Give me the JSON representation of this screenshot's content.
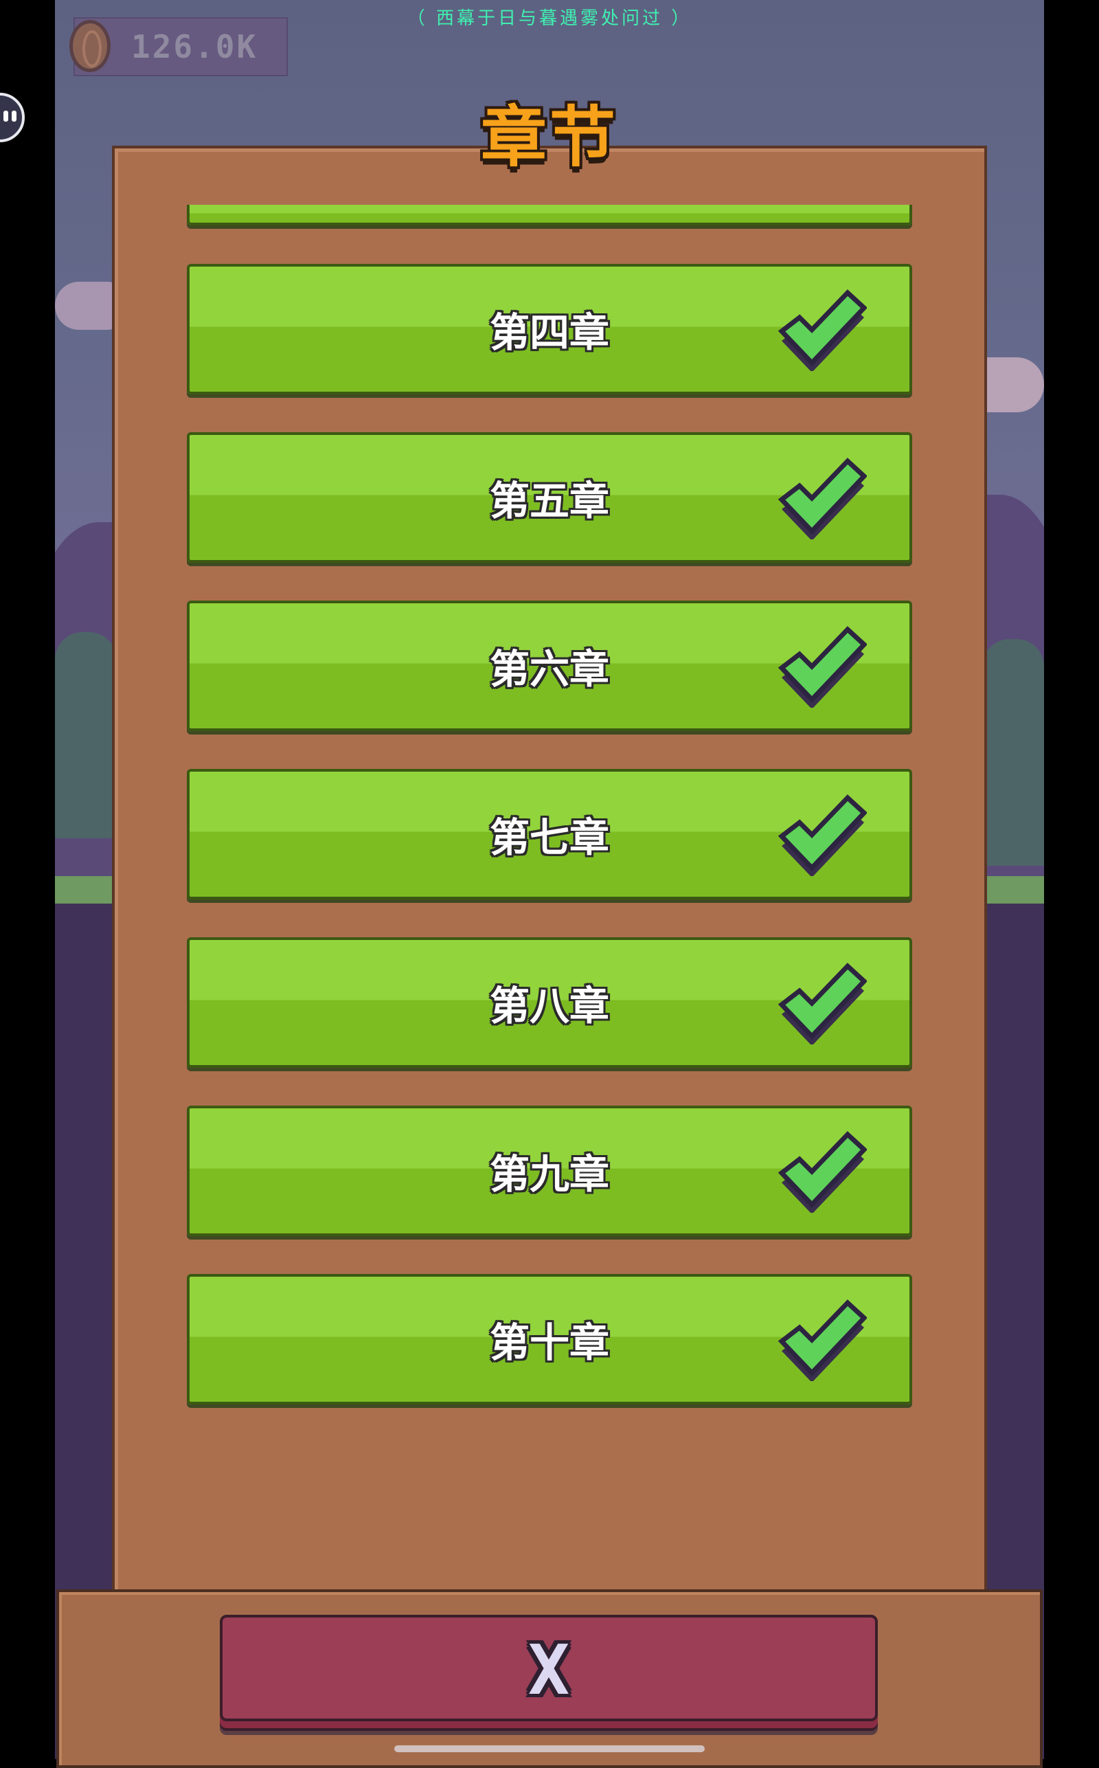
{
  "hud": {
    "subtitle": "（ 西幕于日与暮遇雾处问过 ）",
    "coins": "126.0K",
    "coin_icon": "coin-icon"
  },
  "screen_title": "章节",
  "chapters": [
    {
      "label": "第四章",
      "completed": true
    },
    {
      "label": "第五章",
      "completed": true
    },
    {
      "label": "第六章",
      "completed": true
    },
    {
      "label": "第七章",
      "completed": true
    },
    {
      "label": "第八章",
      "completed": true
    },
    {
      "label": "第九章",
      "completed": true
    },
    {
      "label": "第十章",
      "completed": true
    }
  ],
  "close_button": {
    "label": "X"
  },
  "colors": {
    "button_green": "#92d43c",
    "button_green_dark": "#7dbd22",
    "check_fill": "#5fd25a",
    "check_outline": "#2c2440",
    "panel_brown": "#ac6f4e",
    "close_red": "#9b3e56",
    "title_orange": "#f7a21a"
  }
}
